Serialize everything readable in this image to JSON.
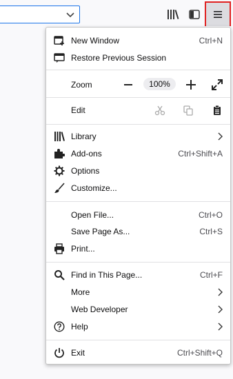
{
  "menu": {
    "new_window": {
      "label": "New Window",
      "shortcut": "Ctrl+N"
    },
    "restore_session": {
      "label": "Restore Previous Session"
    },
    "zoom": {
      "label": "Zoom",
      "value": "100%"
    },
    "edit": {
      "label": "Edit"
    },
    "library": {
      "label": "Library"
    },
    "addons": {
      "label": "Add-ons",
      "shortcut": "Ctrl+Shift+A"
    },
    "options": {
      "label": "Options"
    },
    "customize": {
      "label": "Customize..."
    },
    "open_file": {
      "label": "Open File...",
      "shortcut": "Ctrl+O"
    },
    "save_page": {
      "label": "Save Page As...",
      "shortcut": "Ctrl+S"
    },
    "print": {
      "label": "Print..."
    },
    "find": {
      "label": "Find in This Page...",
      "shortcut": "Ctrl+F"
    },
    "more": {
      "label": "More"
    },
    "web_developer": {
      "label": "Web Developer"
    },
    "help": {
      "label": "Help"
    },
    "exit": {
      "label": "Exit",
      "shortcut": "Ctrl+Shift+Q"
    }
  },
  "icons": {
    "toolbar": [
      "chevron-down-icon",
      "library-icon",
      "sidebar-icon",
      "hamburger-menu-icon"
    ],
    "menu": [
      "new-window-icon",
      "restore-session-icon",
      "zoom-out-icon",
      "zoom-in-icon",
      "fullscreen-icon",
      "cut-icon",
      "copy-icon",
      "paste-icon",
      "library-icon",
      "addons-icon",
      "gear-icon",
      "paintbrush-icon",
      "printer-icon",
      "search-icon",
      "help-icon",
      "power-icon",
      "chevron-right-icon"
    ]
  },
  "colors": {
    "menu_button_highlight": "#e02020",
    "urlbar_focus": "#1a73e8"
  }
}
